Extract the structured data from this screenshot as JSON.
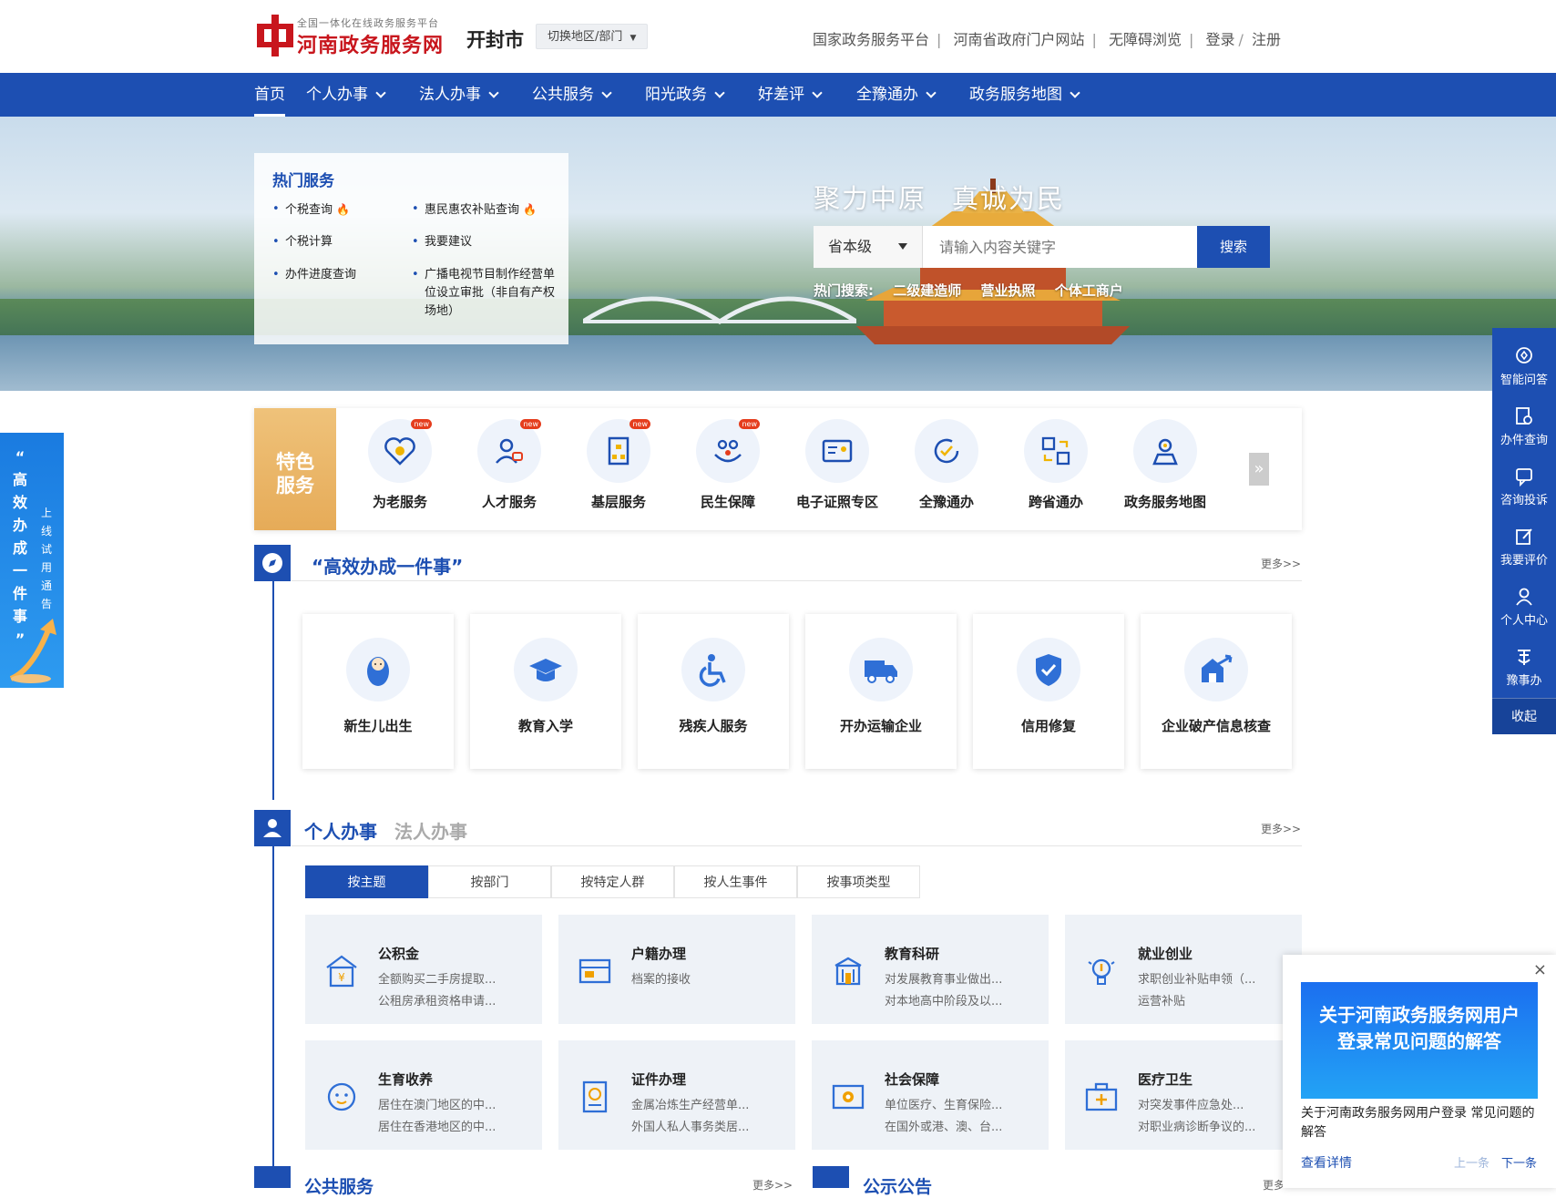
{
  "header": {
    "logo_sub": "全国一体化在线政务服务平台",
    "logo_title": "河南政务服务网",
    "city": "开封市",
    "switch_label": "切换地区/部门",
    "links": [
      "国家政务服务平台",
      "河南省政府门户网站",
      "无障碍浏览",
      "登录",
      "注册"
    ]
  },
  "nav": {
    "items": [
      "首页",
      "个人办事",
      "法人办事",
      "公共服务",
      "阳光政务",
      "好差评",
      "全豫通办",
      "政务服务地图"
    ]
  },
  "banner": {
    "hot_title": "热门服务",
    "hot_items": [
      "个税查询",
      "惠民惠农补贴查询",
      "个税计算",
      "我要建议",
      "办件进度查询",
      "广播电视节目制作经营单位设立审批（非自有产权场地）"
    ],
    "slogan_a": "聚力中原",
    "slogan_b": "真诚为民",
    "search_level": "省本级",
    "search_placeholder": "请输入内容关键字",
    "search_button": "搜索",
    "hot_search_label": "热门搜索:",
    "hot_search_terms": [
      "二级建造师",
      "营业执照",
      "个体工商户"
    ]
  },
  "featured": {
    "label_top": "特色",
    "label_bottom": "服务",
    "new_badge": "new",
    "items": [
      "为老服务",
      "人才服务",
      "基层服务",
      "民生保障",
      "电子证照专区",
      "全豫通办",
      "跨省通办",
      "政务服务地图"
    ],
    "next_arrow": "»"
  },
  "efficient": {
    "title": "“高效办成一件事”",
    "more": "更多>>",
    "cases": [
      "新生儿出生",
      "教育入学",
      "残疾人服务",
      "开办运输企业",
      "信用修复",
      "企业破产信息核查"
    ]
  },
  "personal": {
    "title": "个人办事",
    "alt_title": "法人办事",
    "more": "更多>>",
    "tabs": [
      "按主题",
      "按部门",
      "按特定人群",
      "按人生事件",
      "按事项类型"
    ],
    "themes": [
      {
        "title": "公积金",
        "d1": "全额购买二手房提取...",
        "d2": "公租房承租资格申请..."
      },
      {
        "title": "户籍办理",
        "d1": "档案的接收",
        "d2": ""
      },
      {
        "title": "教育科研",
        "d1": "对发展教育事业做出...",
        "d2": "对本地高中阶段及以..."
      },
      {
        "title": "就业创业",
        "d1": "求职创业补贴申领（...",
        "d2": "运营补贴"
      },
      {
        "title": "生育收养",
        "d1": "居住在澳门地区的中...",
        "d2": "居住在香港地区的中..."
      },
      {
        "title": "证件办理",
        "d1": "金属冶炼生产经营单...",
        "d2": "外国人私人事务类居..."
      },
      {
        "title": "社会保障",
        "d1": "单位医疗、生育保险...",
        "d2": "在国外或港、澳、台..."
      },
      {
        "title": "医疗卫生",
        "d1": "对突发事件应急处...",
        "d2": "对职业病诊断争议的..."
      }
    ]
  },
  "bottom": {
    "public_title": "公共服务",
    "public_more": "更多>>",
    "notice_title": "公示公告",
    "notice_more": "更多"
  },
  "right_toolbar": {
    "items": [
      "智能问答",
      "办件查询",
      "咨询投诉",
      "我要评价",
      "个人中心",
      "豫事办"
    ],
    "collapse": "收起"
  },
  "left_banner": {
    "big_text": [
      "“",
      "高",
      "效",
      "办",
      "成",
      "一",
      "件",
      "事",
      "”"
    ],
    "small_text": [
      "上",
      "线",
      "试",
      "用",
      "通",
      "告"
    ]
  },
  "notice_popup": {
    "close": "×",
    "image_text": "关于河南政务服务网用户登录常见问题的解答",
    "text": "关于河南政务服务网用户登录 常见问题的解答",
    "detail": "查看详情",
    "prev": "上一条",
    "next": "下一条"
  },
  "colors": {
    "primary": "#1d4fb2",
    "brand_red": "#c8161d",
    "feature_gold": "#e6ab58"
  }
}
